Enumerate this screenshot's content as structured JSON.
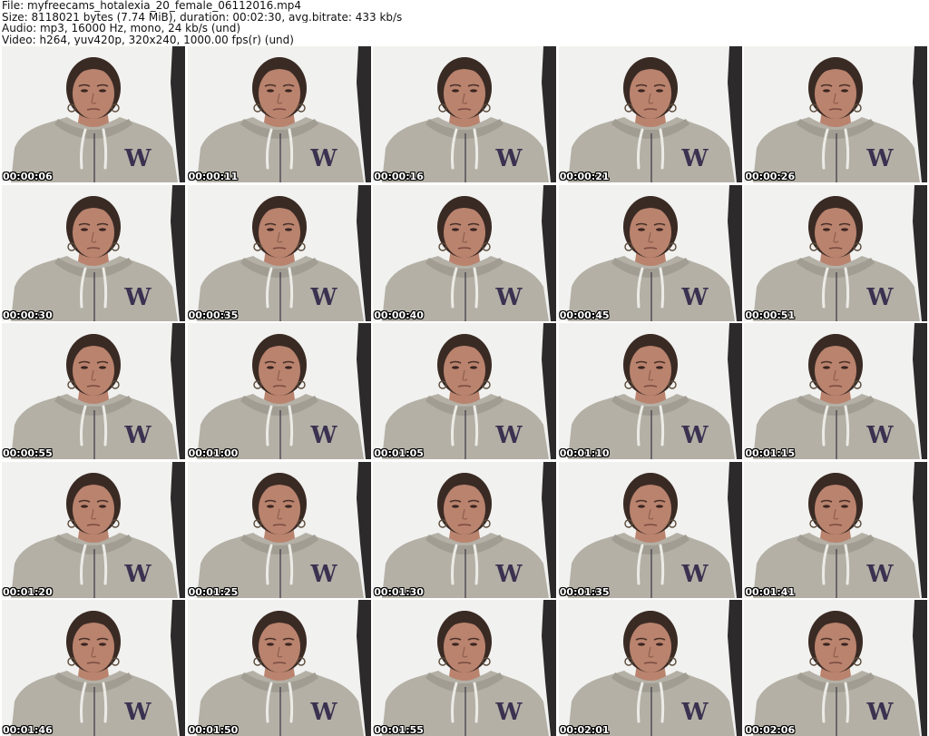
{
  "header": {
    "file_line": "File: myfreecams_hotalexia_20_female_06112016.mp4",
    "size_line": "Size: 8118021 bytes (7.74 MiB), duration: 00:02:30, avg.bitrate: 433 kb/s",
    "audio_line": "Audio: mp3, 16000 Hz, mono, 24 kb/s (und)",
    "video_line": "Video: h264, yuv420p, 320x240, 1000.00 fps(r) (und)"
  },
  "thumbnails": [
    {
      "timecode": "00:00:06"
    },
    {
      "timecode": "00:00:11"
    },
    {
      "timecode": "00:00:16"
    },
    {
      "timecode": "00:00:21"
    },
    {
      "timecode": "00:00:26"
    },
    {
      "timecode": "00:00:30"
    },
    {
      "timecode": "00:00:35"
    },
    {
      "timecode": "00:00:40"
    },
    {
      "timecode": "00:00:45"
    },
    {
      "timecode": "00:00:51"
    },
    {
      "timecode": "00:00:55"
    },
    {
      "timecode": "00:01:00"
    },
    {
      "timecode": "00:01:05"
    },
    {
      "timecode": "00:01:10"
    },
    {
      "timecode": "00:01:15"
    },
    {
      "timecode": "00:01:20"
    },
    {
      "timecode": "00:01:25"
    },
    {
      "timecode": "00:01:30"
    },
    {
      "timecode": "00:01:35"
    },
    {
      "timecode": "00:01:41"
    },
    {
      "timecode": "00:01:46"
    },
    {
      "timecode": "00:01:50"
    },
    {
      "timecode": "00:01:55"
    },
    {
      "timecode": "00:02:01"
    },
    {
      "timecode": "00:02:06"
    }
  ],
  "thumbnail_hoodie_letter": "W",
  "colors": {
    "background": "#ffffff",
    "wall": "#f1f1ef",
    "hoodie": "#b4b0a6",
    "skin": "#b9836e",
    "hair": "#3a2a24",
    "dark_panel": "#2d2a2b",
    "letter": "#3b3150",
    "timecode_text": "#ffffff",
    "timecode_outline": "#000000"
  }
}
